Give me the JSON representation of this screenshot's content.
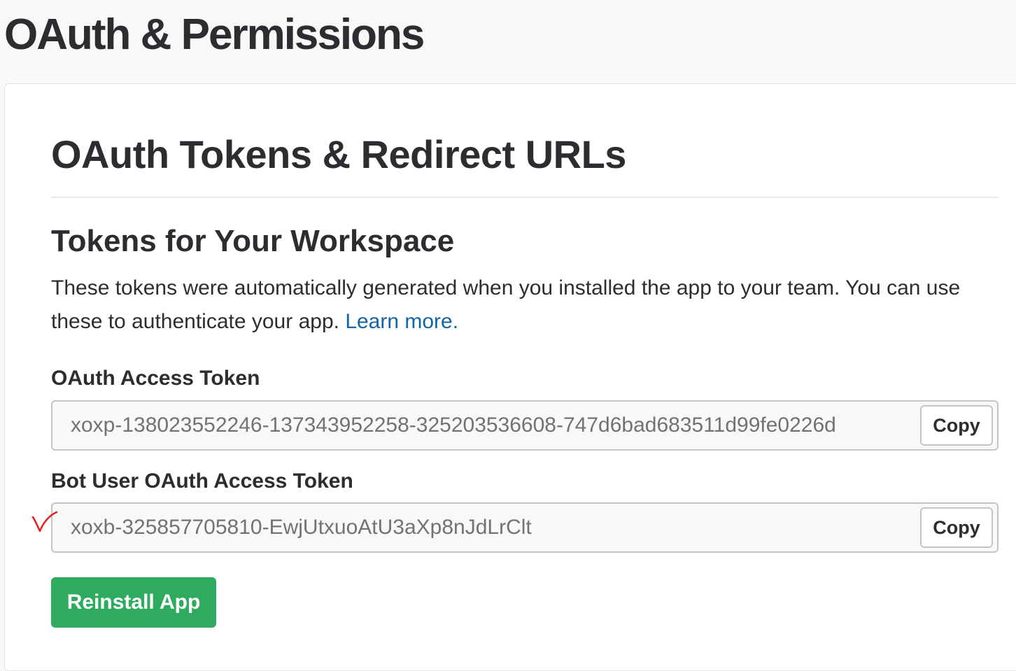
{
  "page": {
    "title": "OAuth & Permissions"
  },
  "section": {
    "title": "OAuth Tokens & Redirect URLs",
    "subtitle": "Tokens for Your Workspace",
    "description": "These tokens were automatically generated when you installed the app to your team. You can use these to authenticate your app.",
    "learn_more_label": "Learn more."
  },
  "tokens": [
    {
      "label": "OAuth Access Token",
      "value": "xoxp-138023552246-137343952258-325203536608-747d6bad683511d99fe0226d",
      "copy_label": "Copy"
    },
    {
      "label": "Bot User OAuth Access Token",
      "value": "xoxb-325857705810-EwjUtxuoAtU3aXp8nJdLrClt",
      "copy_label": "Copy"
    }
  ],
  "actions": {
    "reinstall_label": "Reinstall App",
    "reinstall_color": "#2eab5e"
  },
  "colors": {
    "link": "#1264a3",
    "annotation": "#e02020"
  },
  "annotation": {
    "icon": "red-checkmark-icon"
  }
}
